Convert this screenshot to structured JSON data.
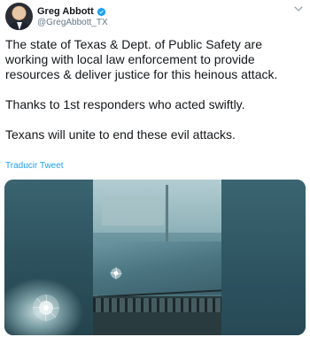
{
  "author": {
    "name": "Greg Abbott",
    "handle": "@GregAbbott_TX",
    "verified": true
  },
  "icons": {
    "verified": "verified-badge-icon",
    "caret": "chevron-down-icon"
  },
  "tweet": {
    "paragraphs": [
      "The state of Texas & Dept. of Public Safety are working with local law enforcement to provide resources & deliver justice for this heinous attack.",
      "Thanks to 1st responders who acted swiftly.",
      "Texans will unite to end these evil attacks."
    ],
    "translate_label": "Traducir Tweet"
  },
  "colors": {
    "accent": "#1da1f2",
    "text": "#14171a",
    "secondary": "#657786"
  }
}
